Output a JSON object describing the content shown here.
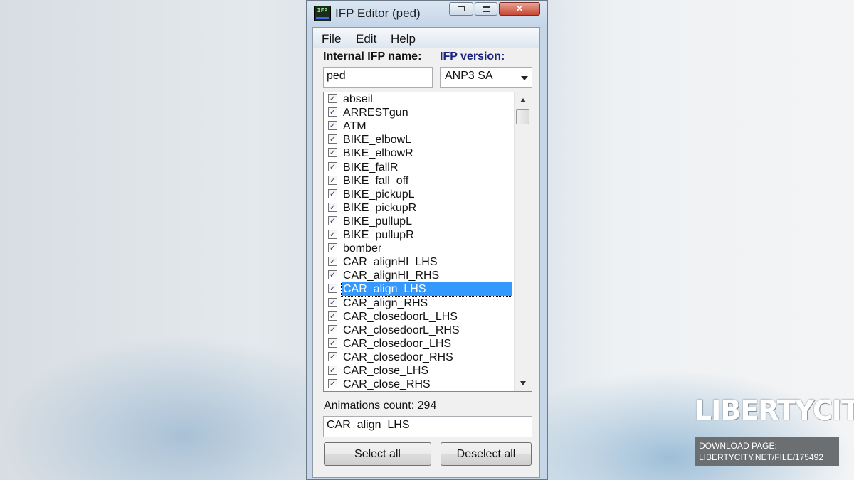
{
  "window": {
    "title": "IFP Editor (ped)",
    "app_icon_text": "IFP",
    "close_glyph": "✕"
  },
  "menu": [
    "File",
    "Edit",
    "Help"
  ],
  "fields": {
    "internal_name_label": "Internal IFP name:",
    "internal_name_value": "ped",
    "version_label": "IFP version:",
    "version_value": "ANP3 SA"
  },
  "animations": {
    "items": [
      {
        "label": "abseil",
        "checked": true
      },
      {
        "label": "ARRESTgun",
        "checked": true
      },
      {
        "label": "ATM",
        "checked": true
      },
      {
        "label": "BIKE_elbowL",
        "checked": true
      },
      {
        "label": "BIKE_elbowR",
        "checked": true
      },
      {
        "label": "BIKE_fallR",
        "checked": true
      },
      {
        "label": "BIKE_fall_off",
        "checked": true
      },
      {
        "label": "BIKE_pickupL",
        "checked": true
      },
      {
        "label": "BIKE_pickupR",
        "checked": true
      },
      {
        "label": "BIKE_pullupL",
        "checked": true
      },
      {
        "label": "BIKE_pullupR",
        "checked": true
      },
      {
        "label": "bomber",
        "checked": true
      },
      {
        "label": "CAR_alignHI_LHS",
        "checked": true
      },
      {
        "label": "CAR_alignHI_RHS",
        "checked": true
      },
      {
        "label": "CAR_align_LHS",
        "checked": true,
        "selected": true
      },
      {
        "label": "CAR_align_RHS",
        "checked": true
      },
      {
        "label": "CAR_closedoorL_LHS",
        "checked": true
      },
      {
        "label": "CAR_closedoorL_RHS",
        "checked": true
      },
      {
        "label": "CAR_closedoor_LHS",
        "checked": true
      },
      {
        "label": "CAR_closedoor_RHS",
        "checked": true
      },
      {
        "label": "CAR_close_LHS",
        "checked": true
      },
      {
        "label": "CAR_close_RHS",
        "checked": true
      }
    ],
    "count_label": "Animations count:",
    "count_value": "294",
    "selected_name": "CAR_align_LHS"
  },
  "buttons": {
    "select_all": "Select all",
    "deselect_all": "Deselect all"
  },
  "watermark": {
    "logo_text": "LIBERTYCITY",
    "line1": "DOWNLOAD PAGE:",
    "line2": "LIBERTYCITY.NET/FILE/175492"
  }
}
